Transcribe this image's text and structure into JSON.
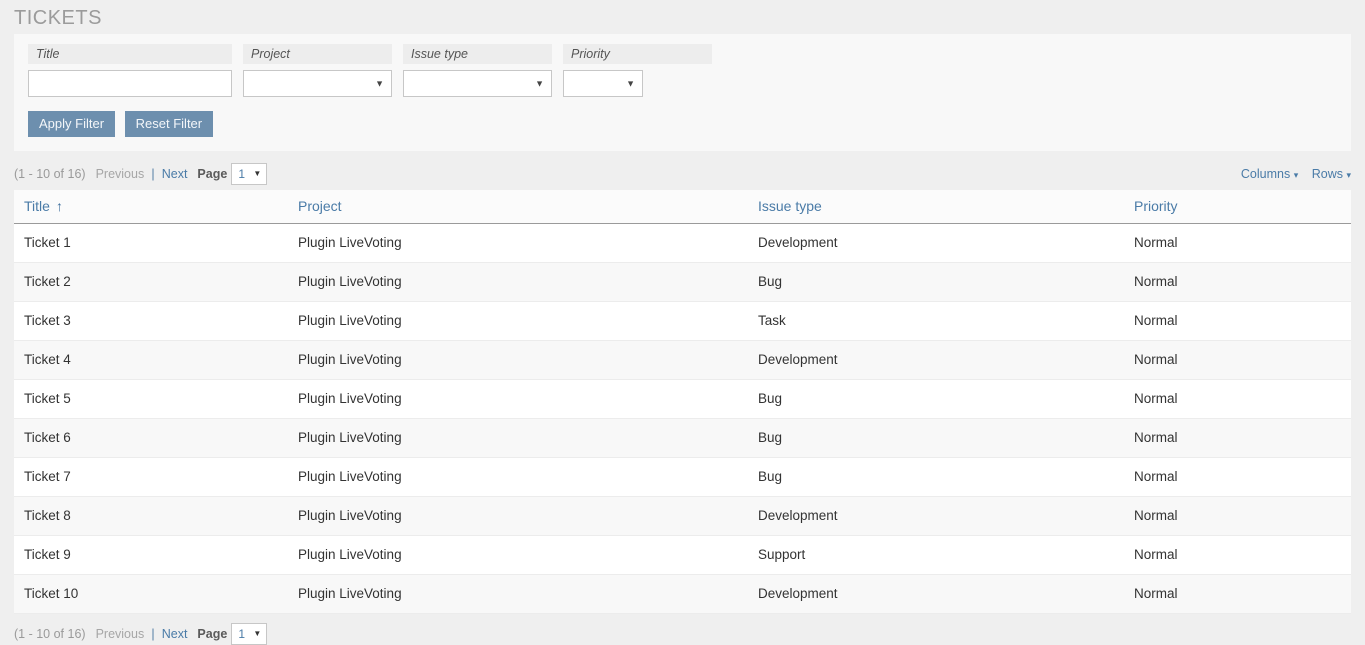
{
  "page": {
    "title": "TICKETS"
  },
  "filters": {
    "fields": [
      {
        "label": "Title",
        "type": "text",
        "value": "",
        "placeholder": ""
      },
      {
        "label": "Project",
        "type": "select",
        "value": ""
      },
      {
        "label": "Issue type",
        "type": "select",
        "value": ""
      },
      {
        "label": "Priority",
        "type": "select",
        "value": ""
      }
    ],
    "apply_label": "Apply Filter",
    "reset_label": "Reset Filter",
    "caret_icon": "▼"
  },
  "toolbar": {
    "count_text": "(1 - 10 of 16)",
    "previous_label": "Previous",
    "separator": "|",
    "next_label": "Next",
    "page_label": "Page",
    "page_value": "1",
    "page_caret_icon": "▼",
    "columns_label": "Columns",
    "rows_label": "Rows",
    "menu_caret_icon": "▾"
  },
  "table": {
    "columns": [
      {
        "label": "Title",
        "sorted": "asc",
        "sort_icon": "↑"
      },
      {
        "label": "Project",
        "sorted": "",
        "sort_icon": ""
      },
      {
        "label": "Issue type",
        "sorted": "",
        "sort_icon": ""
      },
      {
        "label": "Priority",
        "sorted": "",
        "sort_icon": ""
      }
    ],
    "rows": [
      {
        "title": "Ticket 1",
        "project": "Plugin LiveVoting",
        "issue_type": "Development",
        "priority": "Normal"
      },
      {
        "title": "Ticket 2",
        "project": "Plugin LiveVoting",
        "issue_type": "Bug",
        "priority": "Normal"
      },
      {
        "title": "Ticket 3",
        "project": "Plugin LiveVoting",
        "issue_type": "Task",
        "priority": "Normal"
      },
      {
        "title": "Ticket 4",
        "project": "Plugin LiveVoting",
        "issue_type": "Development",
        "priority": "Normal"
      },
      {
        "title": "Ticket 5",
        "project": "Plugin LiveVoting",
        "issue_type": "Bug",
        "priority": "Normal"
      },
      {
        "title": "Ticket 6",
        "project": "Plugin LiveVoting",
        "issue_type": "Bug",
        "priority": "Normal"
      },
      {
        "title": "Ticket 7",
        "project": "Plugin LiveVoting",
        "issue_type": "Bug",
        "priority": "Normal"
      },
      {
        "title": "Ticket 8",
        "project": "Plugin LiveVoting",
        "issue_type": "Development",
        "priority": "Normal"
      },
      {
        "title": "Ticket 9",
        "project": "Plugin LiveVoting",
        "issue_type": "Support",
        "priority": "Normal"
      },
      {
        "title": "Ticket 10",
        "project": "Plugin LiveVoting",
        "issue_type": "Development",
        "priority": "Normal"
      }
    ]
  },
  "footer": {
    "count_text": "(1 - 10 of 16)",
    "previous_label": "Previous",
    "separator": "|",
    "next_label": "Next",
    "page_label": "Page",
    "page_value": "1",
    "page_caret_icon": "▼"
  },
  "colors": {
    "accent_link": "#4a7ba7",
    "button_bg": "#6d8fae",
    "page_bg": "#efefef",
    "panel_bg": "#f8f8f8",
    "row_alt_bg": "#f8f8f8"
  }
}
